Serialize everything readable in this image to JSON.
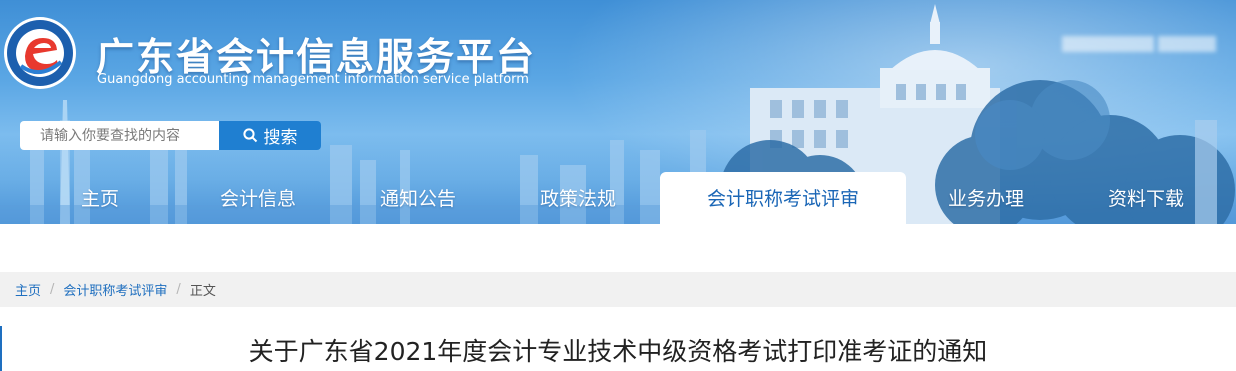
{
  "site": {
    "title": "广东省会计信息服务平台",
    "subtitle": "Guangdong accounting management information service platform"
  },
  "search": {
    "placeholder": "请输入你要查找的内容",
    "button_label": "搜索"
  },
  "nav": {
    "items": [
      {
        "label": "主页",
        "active": false
      },
      {
        "label": "会计信息",
        "active": false
      },
      {
        "label": "通知公告",
        "active": false
      },
      {
        "label": "政策法规",
        "active": false
      },
      {
        "label": "会计职称考试评审",
        "active": true
      },
      {
        "label": "业务办理",
        "active": false
      },
      {
        "label": "资料下载",
        "active": false
      }
    ]
  },
  "breadcrumb": {
    "home": "主页",
    "section": "会计职称考试评审",
    "current": "正文",
    "separator": "/"
  },
  "article": {
    "title": "关于广东省2021年度会计专业技术中级资格考试打印准考证的通知"
  },
  "colors": {
    "brand_blue": "#1f7fd1",
    "active_nav_text": "#1a66b6",
    "link_blue": "#1f6fbf"
  }
}
